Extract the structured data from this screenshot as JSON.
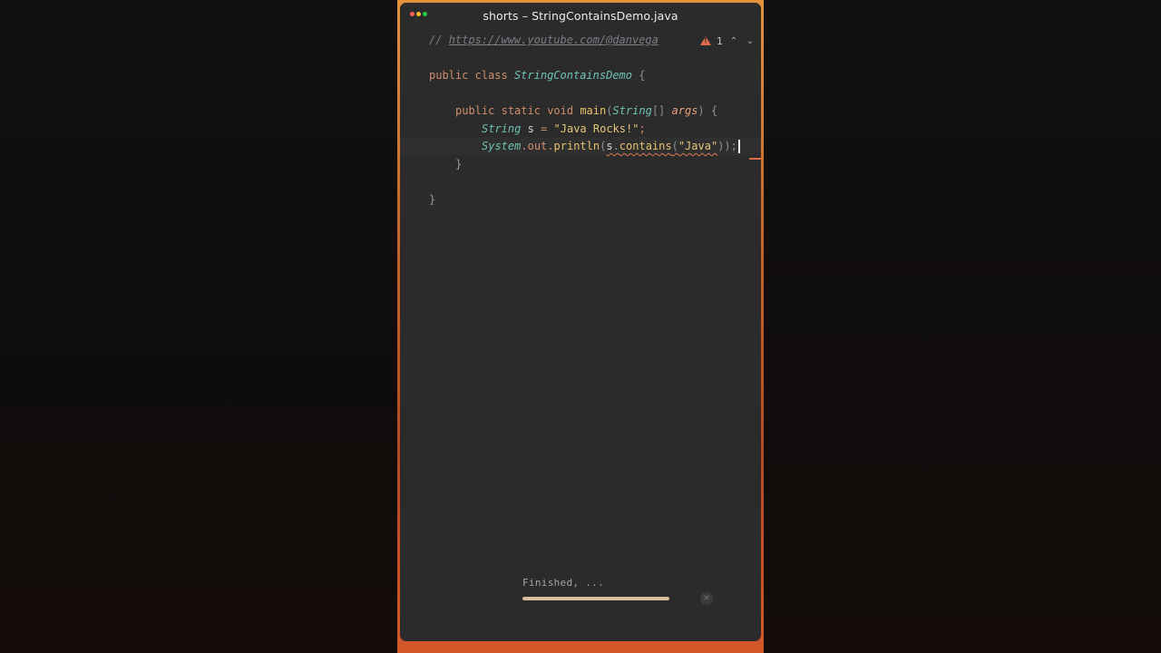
{
  "window": {
    "title": "shorts – StringContainsDemo.java"
  },
  "inspections": {
    "warning_count": "1",
    "up_chevron": "⌃",
    "down_chevron": "⌄"
  },
  "code": {
    "comment_prefix": "// ",
    "comment_url": "https://www.youtube.com/@danvega",
    "l3": {
      "kw1": "public",
      "kw2": "class",
      "name": "StringContainsDemo",
      "brace": "{"
    },
    "l5": {
      "kw1": "public",
      "kw2": "static",
      "kw3": "void",
      "method": "main",
      "lparen": "(",
      "type": "String",
      "brackets": "[]",
      "param": "args",
      "rest": ") {"
    },
    "l6": {
      "type": "String",
      "var": "s",
      "eq": " = ",
      "str": "\"Java Rocks!\"",
      "semi": ";"
    },
    "l7": {
      "cls": "System",
      "dot1": ".",
      "field": "out",
      "dot2": ".",
      "method": "println",
      "lparen": "(",
      "var": "s",
      "dot3": ".",
      "call": "contains",
      "lp2": "(",
      "str": "\"Java\"",
      "close": "));"
    },
    "l8": {
      "brace": "}"
    },
    "l10": {
      "brace": "}"
    }
  },
  "progress": {
    "label": "Finished, ...",
    "value": 1.0,
    "close_symbol": "✕"
  },
  "colors": {
    "accent_warning": "#e06c4c",
    "keyword": "#cf8e6d",
    "class_name": "#6fc2b3",
    "string": "#e6c67a",
    "background": "#2b2b2b"
  }
}
